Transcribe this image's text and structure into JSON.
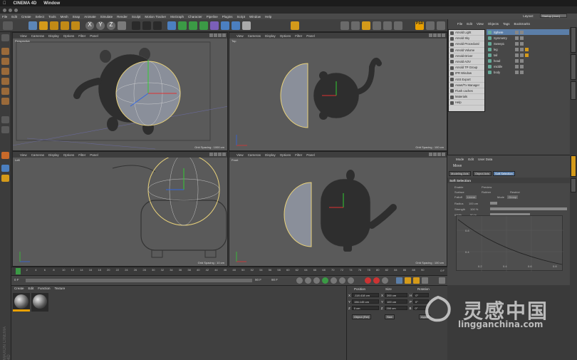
{
  "mac_menu": {
    "app": "CINEMA 4D",
    "window": "Window"
  },
  "menu": [
    "File",
    "Edit",
    "Create",
    "Select",
    "Tools",
    "Mesh",
    "Snap",
    "Animate",
    "Simulate",
    "Render",
    "Sculpt",
    "Motion Tracker",
    "MoGraph",
    "Character",
    "Pipeline",
    "Plugins",
    "Script",
    "Window",
    "Help"
  ],
  "layout": {
    "label": "Layout:",
    "value": "Startup (User)"
  },
  "toolbar_labels": {
    "x": "X",
    "y": "Y",
    "z": "Z",
    "psr": "PSR"
  },
  "viewport_menu": [
    "View",
    "Cameras",
    "Display",
    "Options",
    "Filter",
    "Panel"
  ],
  "viewports": [
    {
      "name": "Perspective",
      "grid": "Grid Spacing : 1000 cm"
    },
    {
      "name": "Top",
      "grid": "Grid Spacing : 100 cm"
    },
    {
      "name": "Left",
      "grid": "Grid Spacing : 10 cm"
    },
    {
      "name": "Front",
      "grid": "Grid Spacing : 100 cm"
    }
  ],
  "objects_menu": [
    "File",
    "Edit",
    "View",
    "Objects",
    "Tags",
    "Bookmarks"
  ],
  "arnold_menu": [
    "Arnold Light",
    "Arnold Sky",
    "Arnold Procedural",
    "Arnold Volume",
    "Arnold Driver",
    "Arnold AOV",
    "Arnold TP Group",
    "IPR Window",
    "ASS Export",
    "Asset/Tx Manager",
    "Flush caches",
    "Materials",
    "Help"
  ],
  "objects": [
    {
      "name": "Sphere",
      "selected": true
    },
    {
      "name": "Symmetry",
      "selected": false
    },
    {
      "name": "Sweep1",
      "selected": false
    },
    {
      "name": "leg",
      "selected": false
    },
    {
      "name": "tail",
      "selected": false
    },
    {
      "name": "head",
      "selected": false
    },
    {
      "name": "middle",
      "selected": false
    },
    {
      "name": "body",
      "selected": false
    }
  ],
  "attr_menu": [
    "Mode",
    "Edit",
    "User Data"
  ],
  "attr_tool": "Move",
  "attr_tabs": [
    "Modeling Axis",
    "Object Axis",
    "Soft Selection"
  ],
  "soft_selection": {
    "title": "Soft Selection",
    "enable": "Enable",
    "preview": "Preview",
    "surface": "Surface",
    "rubber": "Rubber",
    "restrict": "Restrict",
    "falloff": "Falloff",
    "falloff_value": "Linear",
    "mode": "Mode",
    "mode_value": "Group",
    "radius": "Radius",
    "radius_value": "100 cm",
    "strength": "Strength",
    "strength_value": "100 %",
    "width": "Width",
    "width_value": "50 %"
  },
  "graph_ticks": {
    "y": [
      "0.8",
      "0.4"
    ],
    "x": [
      "0.2",
      "0.4",
      "0.6",
      "0.8"
    ]
  },
  "timeline": {
    "ticks": [
      "0",
      "2",
      "4",
      "6",
      "8",
      "10",
      "12",
      "14",
      "16",
      "18",
      "20",
      "22",
      "24",
      "26",
      "28",
      "30",
      "32",
      "34",
      "36",
      "38",
      "40",
      "42",
      "44",
      "46",
      "48",
      "50",
      "52",
      "54",
      "56",
      "58",
      "60",
      "62",
      "64",
      "66",
      "68",
      "70",
      "72",
      "74",
      "76",
      "78",
      "80",
      "82",
      "84",
      "86",
      "88",
      "90"
    ],
    "frame": "0 F",
    "start": "0 F",
    "end": "90 F",
    "end2": "90 F",
    "current": "0 F"
  },
  "materials_menu": [
    "Create",
    "Edit",
    "Function",
    "Texture"
  ],
  "coordinates": {
    "headers": [
      "Position",
      "Size",
      "Rotation"
    ],
    "rows": [
      {
        "axis": "X",
        "pos": "-118.418 cm",
        "size": "200 cm",
        "raxis": "H",
        "rot": "0°"
      },
      {
        "axis": "Y",
        "pos": "156.145 cm",
        "size": "100 cm",
        "raxis": "P",
        "rot": "0°"
      },
      {
        "axis": "Z",
        "pos": "0 cm",
        "size": "200 cm",
        "raxis": "B",
        "rot": "0°"
      }
    ],
    "mode": "Object (Rel)",
    "size_mode": "Size",
    "apply": "Apply"
  },
  "side_label": "MAXON CINEMA 4D",
  "watermark": {
    "cn": "灵感中国",
    "url": "lingganchina.com"
  },
  "colors": {
    "accent": "#e9a000",
    "select": "#5b7ea8",
    "viewport": "#5a5a5a"
  }
}
